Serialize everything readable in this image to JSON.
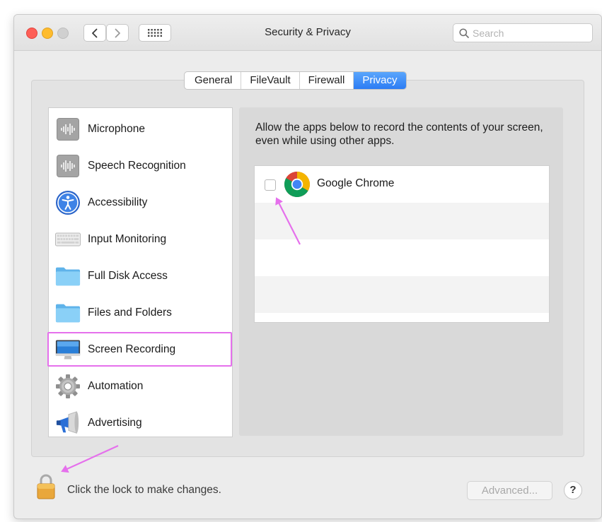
{
  "window": {
    "title": "Security & Privacy",
    "search_placeholder": "Search"
  },
  "tabs": [
    {
      "label": "General",
      "active": false
    },
    {
      "label": "FileVault",
      "active": false
    },
    {
      "label": "Firewall",
      "active": false
    },
    {
      "label": "Privacy",
      "active": true
    }
  ],
  "sidebar": {
    "items": [
      {
        "label": "Microphone",
        "icon": "microphone-icon"
      },
      {
        "label": "Speech Recognition",
        "icon": "speech-recognition-icon"
      },
      {
        "label": "Accessibility",
        "icon": "accessibility-icon"
      },
      {
        "label": "Input Monitoring",
        "icon": "keyboard-icon"
      },
      {
        "label": "Full Disk Access",
        "icon": "folder-icon"
      },
      {
        "label": "Files and Folders",
        "icon": "folder-icon"
      },
      {
        "label": "Screen Recording",
        "icon": "display-icon",
        "selected": true
      },
      {
        "label": "Automation",
        "icon": "gear-icon"
      },
      {
        "label": "Advertising",
        "icon": "megaphone-icon"
      }
    ]
  },
  "main": {
    "description": "Allow the apps below to record the contents of your screen, even while using other apps.",
    "apps": [
      {
        "name": "Google Chrome",
        "checked": false,
        "icon": "chrome-icon"
      }
    ]
  },
  "footer": {
    "lock_text": "Click the lock to make changes.",
    "advanced_label": "Advanced...",
    "help_label": "?"
  },
  "colors": {
    "accent": "#2f7ef5",
    "annotation": "#e570ec",
    "close": "#fe5f57",
    "minimize": "#febc2e"
  }
}
